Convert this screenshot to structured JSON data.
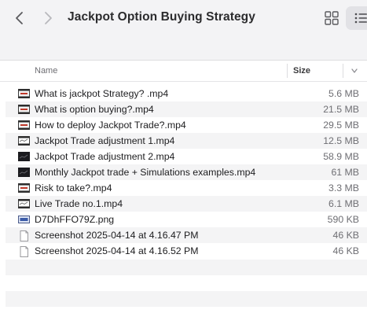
{
  "window": {
    "title": "Jackpot Option Buying Strategy"
  },
  "toolbar": {
    "back_icon": "chevron-left-icon",
    "forward_icon": "chevron-right-icon",
    "grid_view_icon": "grid-view-icon",
    "list_view_icon": "list-view-icon"
  },
  "columns": {
    "name": "Name",
    "size": "Size"
  },
  "files": [
    {
      "name": "What is jackpot Strategy? .mp4",
      "size": "5.6 MB",
      "icon": "video-thumb-light"
    },
    {
      "name": "What is option buying?.mp4",
      "size": "21.5 MB",
      "icon": "video-thumb-light"
    },
    {
      "name": "How to deploy Jackpot Trade?.mp4",
      "size": "29.5 MB",
      "icon": "video-thumb-light"
    },
    {
      "name": "Jackpot Trade adjustment 1.mp4",
      "size": "12.5 MB",
      "icon": "video-thumb-chart"
    },
    {
      "name": "Jackpot Trade adjustment 2.mp4",
      "size": "58.9 MB",
      "icon": "video-thumb-dark"
    },
    {
      "name": "Monthly Jackpot trade + Simulations examples.mp4",
      "size": "61 MB",
      "icon": "video-thumb-dark"
    },
    {
      "name": "Risk to take?.mp4",
      "size": "3.3 MB",
      "icon": "video-thumb-light"
    },
    {
      "name": "Live Trade no.1.mp4",
      "size": "6.1 MB",
      "icon": "video-thumb-chart"
    },
    {
      "name": "D7DhFFO79Z.png",
      "size": "590 KB",
      "icon": "image-thumb"
    },
    {
      "name": "Screenshot 2025-04-14 at 4.16.47 PM",
      "size": "46 KB",
      "icon": "document-icon"
    },
    {
      "name": "Screenshot 2025-04-14 at 4.16.52 PM",
      "size": "46 KB",
      "icon": "document-icon"
    }
  ],
  "colors": {
    "toolbar_bg": "#f3f3f5",
    "row_alt": "#f4f4f5",
    "text": "#1d1d1f",
    "secondary_text": "#6e6e73"
  }
}
